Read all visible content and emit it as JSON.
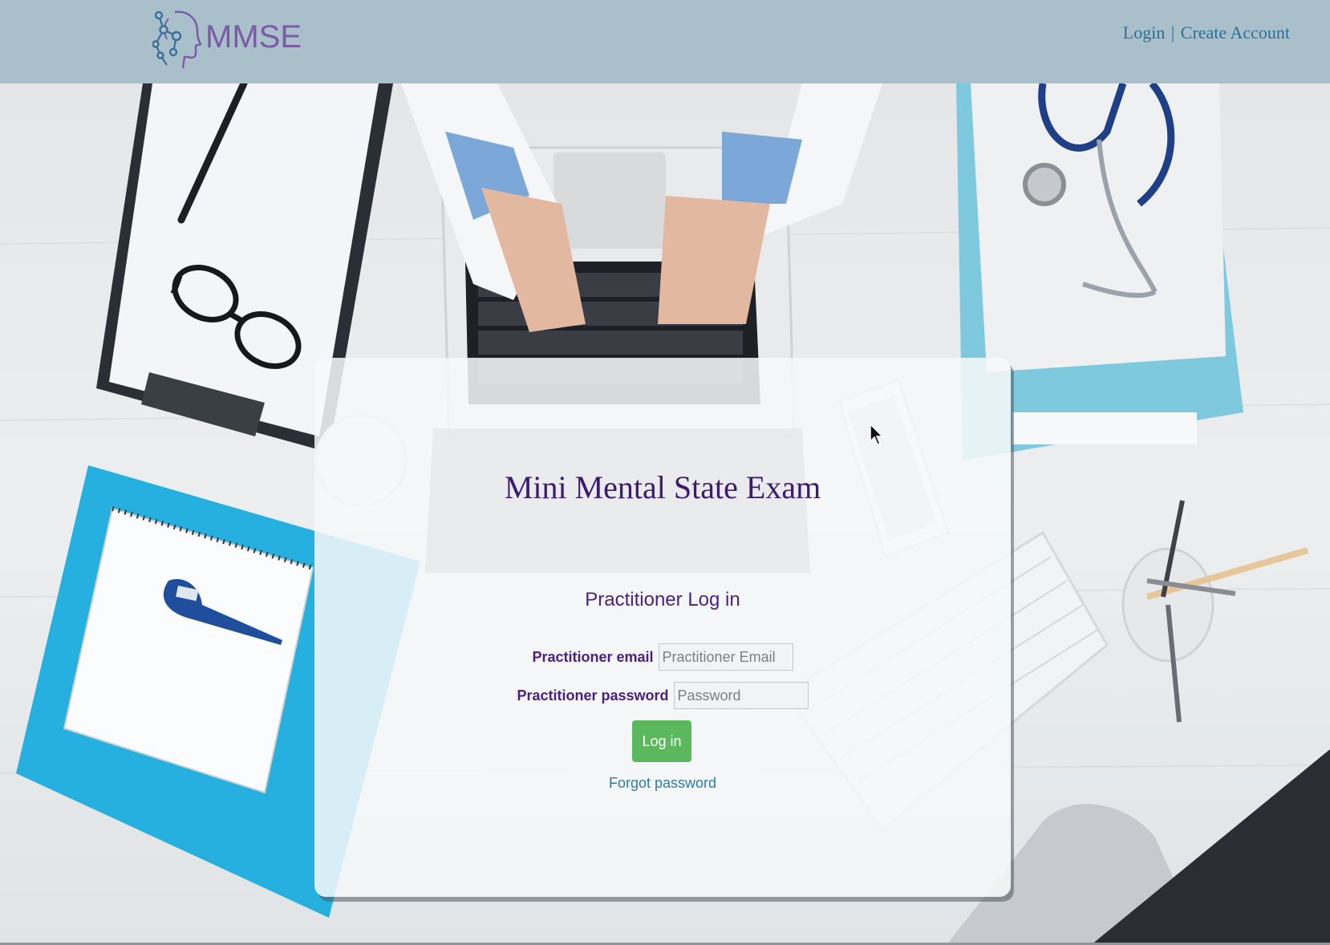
{
  "header": {
    "logo_text": "MMSE",
    "logo_color": "#7b5ba6",
    "links": {
      "login": "Login",
      "separator": "|",
      "create_account": "Create Account"
    }
  },
  "panel": {
    "title": "Mini Mental State Exam",
    "subtitle": "Practitioner Log in",
    "email": {
      "label": "Practitioner email",
      "placeholder": "Practitioner Email",
      "value": ""
    },
    "password": {
      "label": "Practitioner password",
      "placeholder": "Password",
      "value": ""
    },
    "login_button": "Log in",
    "forgot_link": "Forgot password"
  },
  "background_icons": [
    "clipboard-icon",
    "pen-icon",
    "glasses-icon",
    "laptop-icon",
    "stethoscope-icon",
    "notebook-icon",
    "thermometer-icon",
    "phone-icon",
    "keyboard-icon",
    "pencil-cup-icon",
    "monitor-icon"
  ],
  "colors": {
    "header_bg": "#a9c0cb",
    "link": "#2c6f96",
    "title": "#3c1b6e",
    "label": "#4a1f80",
    "button": "#5cb85c"
  }
}
